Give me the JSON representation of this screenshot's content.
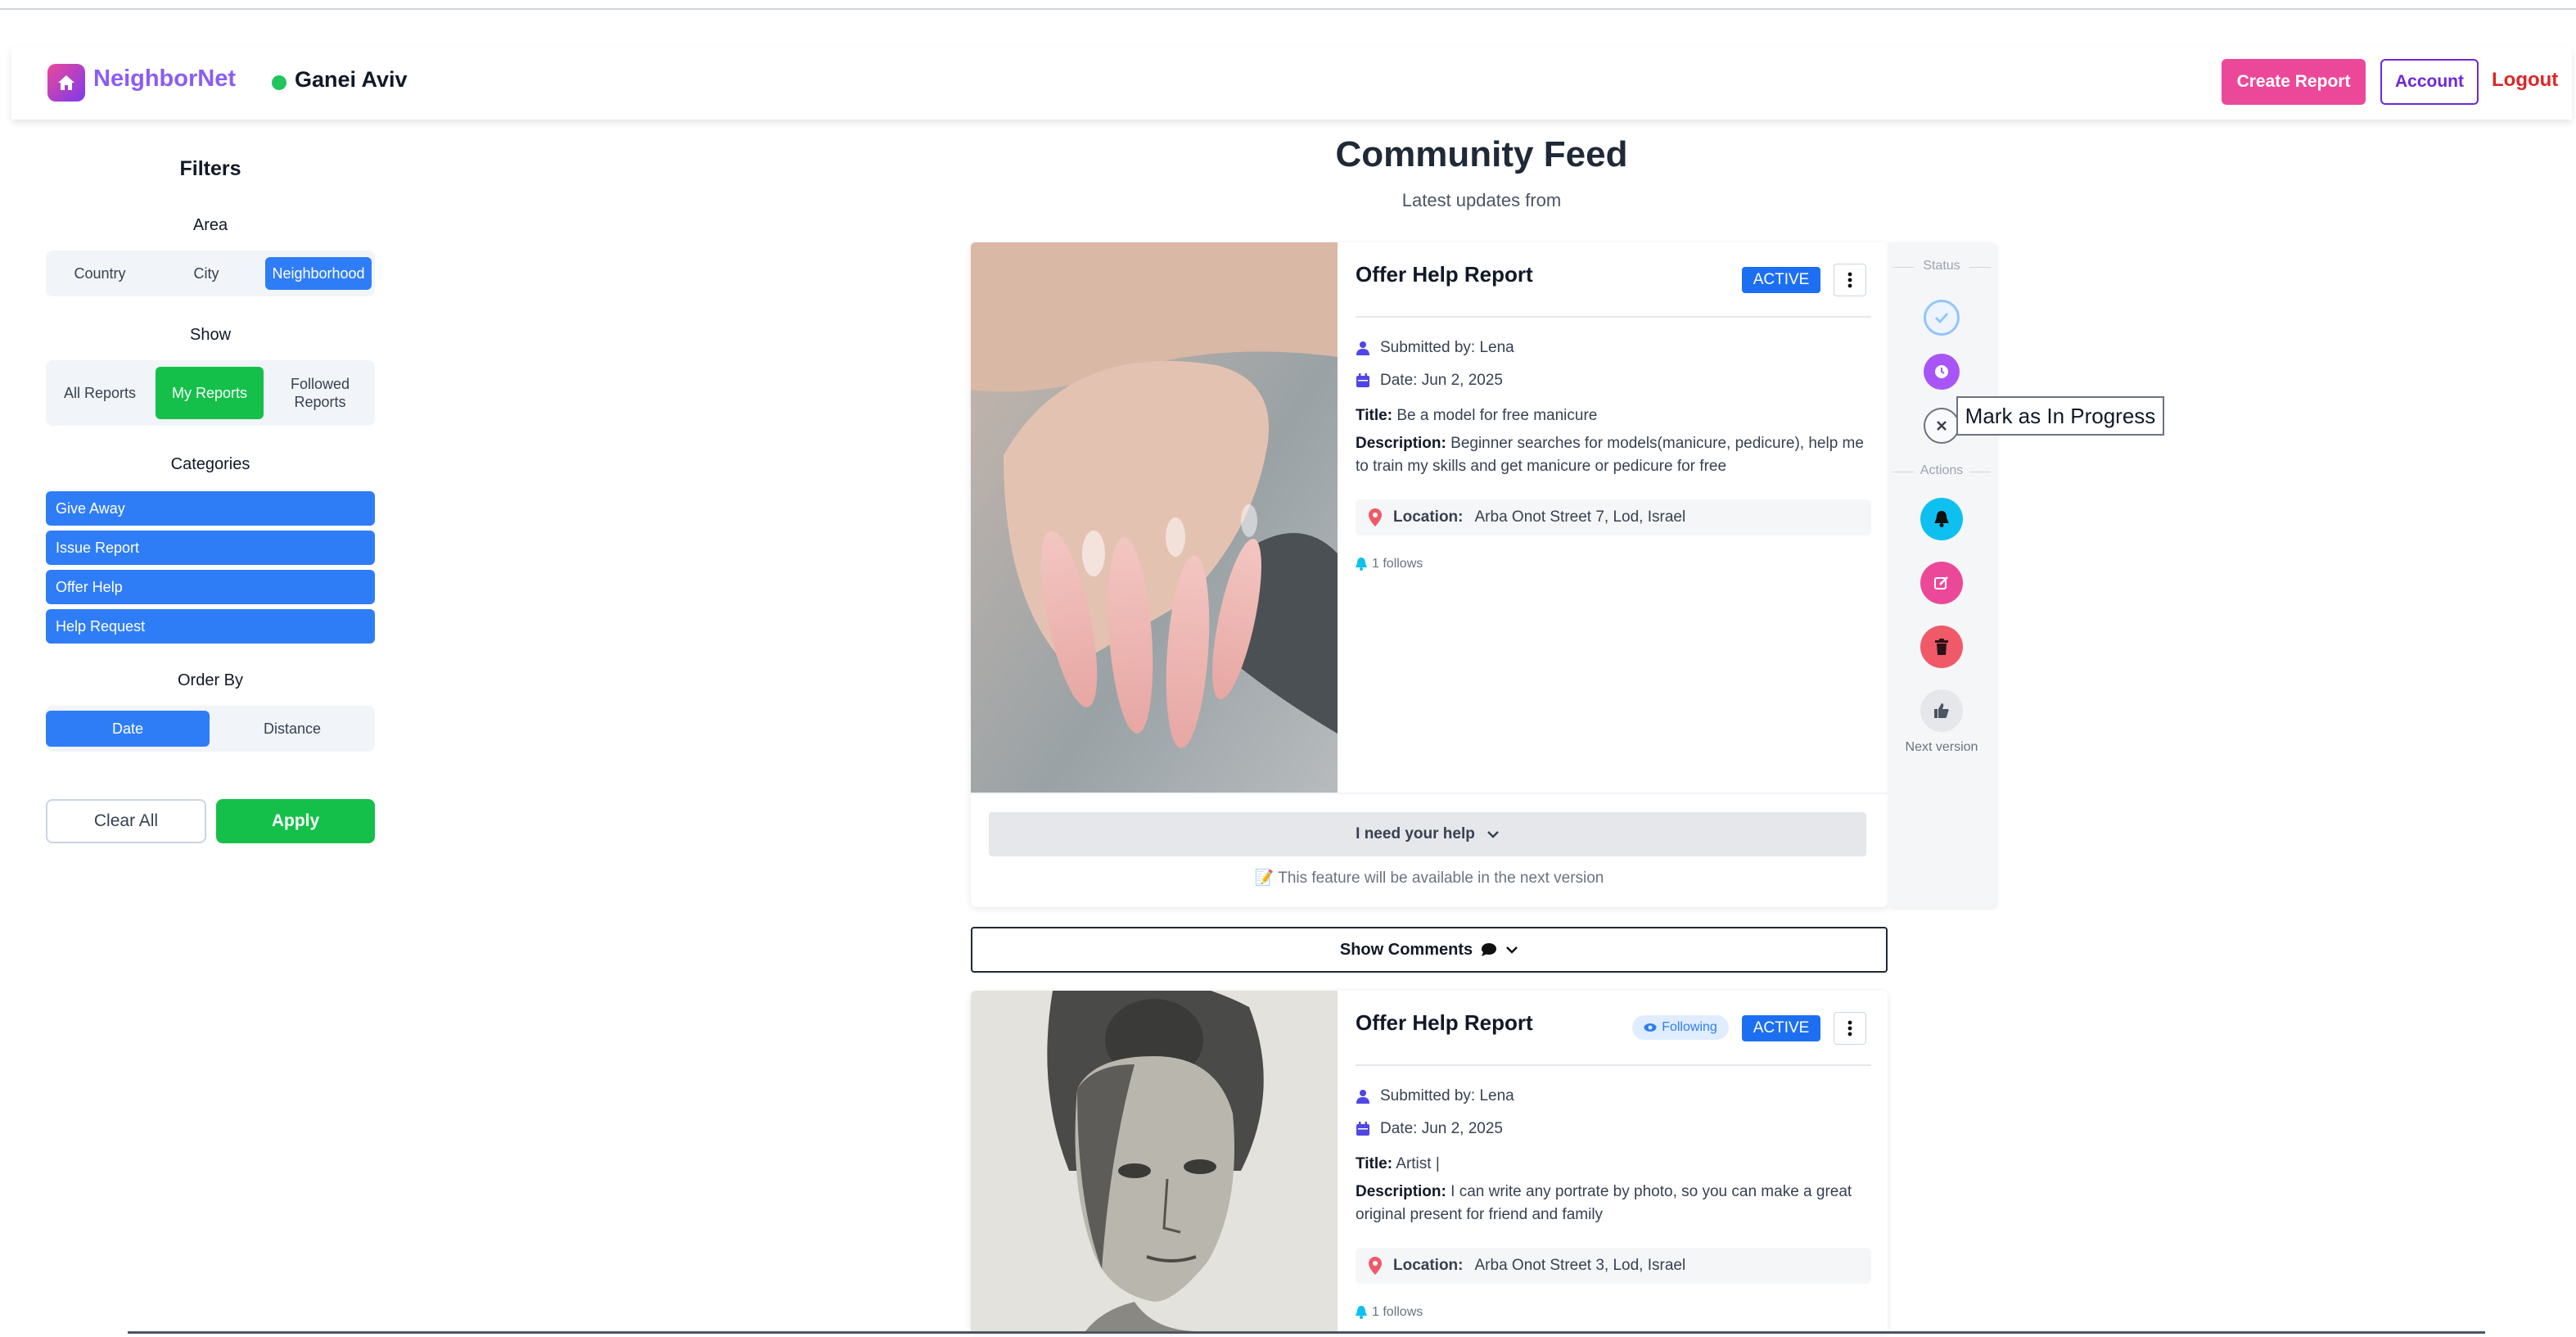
{
  "navbar": {
    "brand": "NeighborNet",
    "location": "Ganei Aviv",
    "create_report": "Create Report",
    "account": "Account",
    "logout": "Logout"
  },
  "filters": {
    "title": "Filters",
    "area": {
      "label": "Area",
      "options": [
        "Country",
        "City",
        "Neighborhood"
      ],
      "selected": "Neighborhood"
    },
    "show": {
      "label": "Show",
      "options": [
        "All Reports",
        "My Reports",
        "Followed Reports"
      ],
      "selected": "My Reports"
    },
    "categories": {
      "label": "Categories",
      "items": [
        "Give Away",
        "Issue Report",
        "Offer Help",
        "Help Request"
      ]
    },
    "order_by": {
      "label": "Order By",
      "options": [
        "Date",
        "Distance"
      ],
      "selected": "Date"
    },
    "clear_all": "Clear All",
    "apply": "Apply"
  },
  "feed": {
    "title": "Community Feed",
    "subtitle": "Latest updates from"
  },
  "cards": [
    {
      "title": "Offer Help Report",
      "status": "ACTIVE",
      "following": null,
      "submitted_by": "Submitted by: Lena",
      "date": "Date: Jun 2, 2025",
      "title_label": "Title:",
      "report_title": "Be a model for free manicure",
      "description_label": "Description:",
      "description": "Beginner searches for models(manicure, pedicure), help me to train my skills and get manicure or pedicure for free",
      "location_label": "Location:",
      "location": "Arba Onot Street 7, Lod, Israel",
      "follows": "1 follows",
      "help_button": "I need your help",
      "feature_note": "📝 This feature will be available in the next version"
    },
    {
      "title": "Offer Help Report",
      "status": "ACTIVE",
      "following": "Following",
      "submitted_by": "Submitted by: Lena",
      "date": "Date: Jun 2, 2025",
      "title_label": "Title:",
      "report_title": "Artist |",
      "description_label": "Description:",
      "description": "I can write any portrate by photo, so you can make a great original present for friend and family",
      "location_label": "Location:",
      "location": "Arba Onot Street 3, Lod, Israel",
      "follows": "1 follows"
    }
  ],
  "show_comments": "Show Comments",
  "side_panel": {
    "status_label": "Status",
    "actions_label": "Actions",
    "next_version_label": "Next version",
    "tooltip": "Mark as In Progress"
  },
  "colors": {
    "brand_gradient_start": "#ec4899",
    "brand_gradient_end": "#7c3aed",
    "primary_blue": "#2f7df6",
    "success_green": "#14c04a",
    "pink": "#ec4899",
    "danger": "#f05a68",
    "purple": "#a855f7",
    "cyan": "#0ec0f0"
  },
  "icons": {
    "logo": "home-icon",
    "user": "user-icon",
    "date": "calendar-icon",
    "location": "map-pin-icon",
    "follows": "bell-icon",
    "comments": "comment-icon",
    "following": "eye-icon"
  }
}
